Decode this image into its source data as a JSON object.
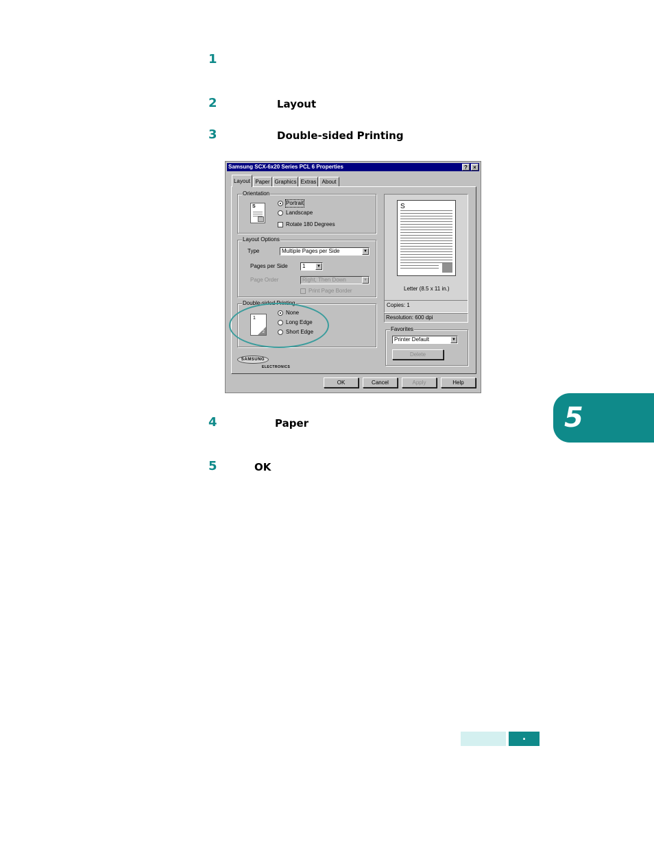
{
  "steps": [
    {
      "num": "1",
      "keyword": ""
    },
    {
      "num": "2",
      "keyword": "Layout"
    },
    {
      "num": "3",
      "keyword": "Double-sided Printing"
    },
    {
      "num": "4",
      "keyword": "Paper"
    },
    {
      "num": "5",
      "keyword": "OK"
    }
  ],
  "dialog": {
    "title": "Samsung SCX-6x20 Series PCL 6 Properties",
    "title_buttons": [
      "?",
      "×"
    ],
    "tabs": [
      "Layout",
      "Paper",
      "Graphics",
      "Extras",
      "About"
    ],
    "orientation": {
      "label": "Orientation",
      "options": [
        "Portrait",
        "Landscape"
      ],
      "selected": "Portrait",
      "rotate_label": "Rotate 180 Degrees"
    },
    "layout_options": {
      "label": "Layout Options",
      "type_label": "Type",
      "type_value": "Multiple Pages per Side",
      "pages_label": "Pages per Side",
      "pages_value": "1",
      "order_label": "Page Order",
      "order_value": "Right, Then Down",
      "border_label": "Print Page Border"
    },
    "double_sided": {
      "label": "Double-sided Printing",
      "options": [
        "None",
        "Long Edge",
        "Short Edge"
      ],
      "selected": "None"
    },
    "preview": {
      "paper": "Letter (8.5 x 11 in.)",
      "copies": "Copies: 1",
      "resolution": "Resolution: 600 dpi"
    },
    "favorites": {
      "label": "Favorites",
      "value": "Printer Default",
      "delete_label": "Delete"
    },
    "logo": {
      "brand": "SAMSUNG",
      "sub": "ELECTRONICS"
    },
    "buttons": [
      "OK",
      "Cancel",
      "Apply",
      "Help"
    ]
  },
  "chapter": "5",
  "footer_dot": "."
}
